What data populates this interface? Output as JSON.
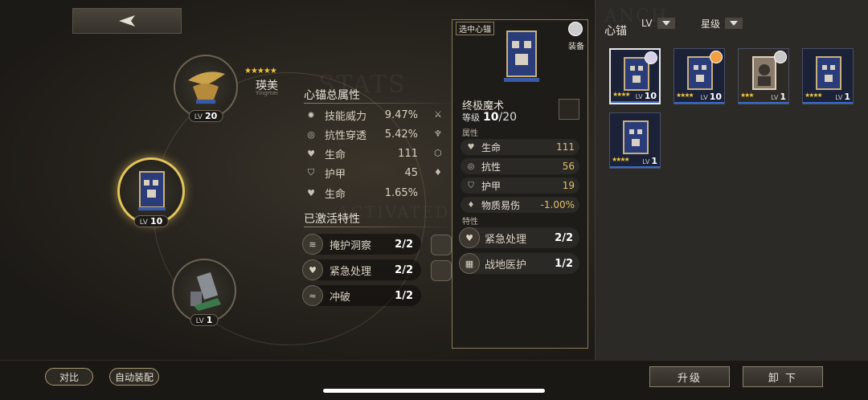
{
  "watermarks": {
    "stats": "STATS",
    "activated": "ACTIVATED",
    "anchor": "ANCH"
  },
  "slots": [
    {
      "lv_label": "LV",
      "lv": "20"
    },
    {
      "lv_label": "LV",
      "lv": "10"
    },
    {
      "lv_label": "LV",
      "lv": "1"
    }
  ],
  "character": {
    "stars": "★★★★★",
    "name": "瑛美",
    "romanized": "Yingmei"
  },
  "summary": {
    "title": "心锚总属性",
    "stats": [
      {
        "icon": "skill-power-icon",
        "label": "技能威力",
        "value": "9.47%"
      },
      {
        "icon": "resist-pierce-icon",
        "label": "抗性穿透",
        "value": "5.42%"
      },
      {
        "icon": "heart-icon",
        "label": "生命",
        "value": "111"
      },
      {
        "icon": "shield-icon",
        "label": "护甲",
        "value": "45"
      },
      {
        "icon": "heart-icon",
        "label": "生命",
        "value": "1.65%"
      }
    ],
    "traits_title": "已激活特性",
    "traits": [
      {
        "label": "掩护洞察",
        "value": "2/2"
      },
      {
        "label": "紧急处理",
        "value": "2/2"
      },
      {
        "label": "冲破",
        "value": "1/2"
      }
    ]
  },
  "popup": {
    "tag": "选中心锚",
    "equip": "装备",
    "name": "终极魔术",
    "level_label": "等级",
    "level": "10",
    "level_max": "/20",
    "attr_title": "属性",
    "attrs": [
      {
        "label": "生命",
        "value": "111"
      },
      {
        "label": "抗性",
        "value": "56"
      },
      {
        "label": "护甲",
        "value": "19"
      },
      {
        "label": "物质易伤",
        "value": "-1.00%"
      }
    ],
    "trait_title": "特性",
    "traits": [
      {
        "label": "紧急处理",
        "value": "2/2"
      },
      {
        "label": "战地医护",
        "value": "1/2"
      }
    ]
  },
  "inventory": {
    "title": "心锚",
    "sort_lv": "LV",
    "sort_star": "星级",
    "cards": [
      {
        "stars": "★★★★",
        "lv_label": "LV",
        "lv": "10",
        "avatar_color": "#d8d0e8"
      },
      {
        "stars": "★★★★",
        "lv_label": "LV",
        "lv": "10",
        "avatar_color": "#f0a040"
      },
      {
        "stars": "★★★",
        "lv_label": "LV",
        "lv": "1",
        "avatar_color": "#c8c8c8"
      },
      {
        "stars": "★★★★",
        "lv_label": "LV",
        "lv": "1",
        "avatar_color": ""
      },
      {
        "stars": "★★★★",
        "lv_label": "LV",
        "lv": "1",
        "avatar_color": ""
      }
    ]
  },
  "bottom": {
    "compare": "对比",
    "auto_equip": "自动装配",
    "upgrade": "升级",
    "unequip": "卸 下"
  }
}
